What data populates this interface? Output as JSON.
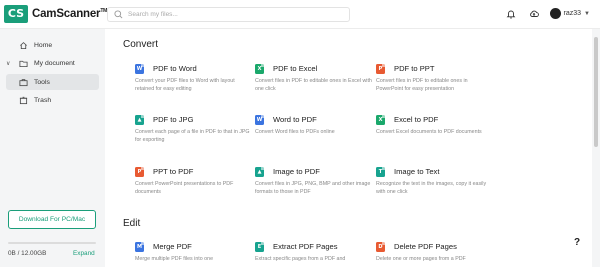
{
  "header": {
    "logo_mark": "CS",
    "logo_text": "CamScanner",
    "logo_tm": "TM",
    "search_placeholder": "Search my files...",
    "username": "raz33",
    "icons": [
      "bell-icon",
      "cloud-upload-icon",
      "user-avatar"
    ]
  },
  "sidebar": {
    "items": [
      {
        "label": "Home",
        "icon": "home-icon"
      },
      {
        "label": "My document",
        "icon": "folder-icon"
      },
      {
        "label": "Tools",
        "icon": "briefcase-icon"
      },
      {
        "label": "Trash",
        "icon": "trash-icon"
      }
    ],
    "download_label": "Download For PC/Mac",
    "storage_text": "0B / 12.00GB",
    "storage_fraction": 0.0,
    "expand_label": "Expand"
  },
  "colors": {
    "brand": "#1a9e7a",
    "word": "#3b74e0",
    "excel": "#1aa86b",
    "ppt": "#e85a32",
    "image": "#17a38f"
  },
  "main": {
    "convert_title": "Convert",
    "edit_title": "Edit",
    "convert_tools": [
      {
        "name": "PDF to Word",
        "desc": "Convert your PDF files to Word with layout retained for easy editing",
        "icon_color": "#3b74e0",
        "glyph": "W"
      },
      {
        "name": "PDF to Excel",
        "desc": "Convert files in PDF to editable ones in Excel with one click",
        "icon_color": "#1aa86b",
        "glyph": "X"
      },
      {
        "name": "PDF to PPT",
        "desc": "Convert files in PDF to editable ones in PowerPoint for easy presentation",
        "icon_color": "#e85a32",
        "glyph": "P"
      },
      {
        "name": "PDF to JPG",
        "desc": "Convert each page of a file in PDF to that in JPG for exporting",
        "icon_color": "#17a38f",
        "glyph": "▲"
      },
      {
        "name": "Word to PDF",
        "desc": "Convert Word files to PDFs online",
        "icon_color": "#3b74e0",
        "glyph": "W"
      },
      {
        "name": "Excel to PDF",
        "desc": "Convert Excel documents to PDF documents",
        "icon_color": "#1aa86b",
        "glyph": "X"
      },
      {
        "name": "PPT to PDF",
        "desc": "Convert PowerPoint presentations to PDF documents",
        "icon_color": "#e85a32",
        "glyph": "P"
      },
      {
        "name": "Image to PDF",
        "desc": "Convert files in JPG, PNG, BMP and other image formats to those in PDF",
        "icon_color": "#17a38f",
        "glyph": "▲"
      },
      {
        "name": "Image to Text",
        "desc": "Recognize the text in the images, copy it easily with one click",
        "icon_color": "#17a38f",
        "glyph": "T"
      }
    ],
    "edit_tools": [
      {
        "name": "Merge PDF",
        "desc": "Merge multiple PDF files into one",
        "icon_color": "#3b74e0",
        "glyph": "M"
      },
      {
        "name": "Extract PDF Pages",
        "desc": "Extract specific pages from a PDF and",
        "icon_color": "#17a38f",
        "glyph": "E"
      },
      {
        "name": "Delete PDF Pages",
        "desc": "Delete one or more pages from a PDF",
        "icon_color": "#e85a32",
        "glyph": "D"
      }
    ]
  },
  "help_label": "?"
}
